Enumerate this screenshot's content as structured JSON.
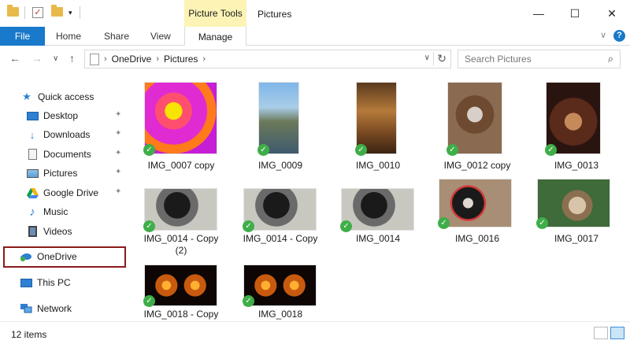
{
  "window": {
    "title": "Pictures",
    "context_tab": "Picture Tools",
    "minimize_glyph": "—",
    "maximize_glyph": "☐",
    "close_glyph": "✕"
  },
  "qat": {
    "dropdown_glyph": "▾",
    "check_glyph": "✓"
  },
  "ribbon": {
    "file_label": "File",
    "tabs": [
      "Home",
      "Share",
      "View"
    ],
    "manage_label": "Manage",
    "collapse_glyph": "∨",
    "help_glyph": "?"
  },
  "nav": {
    "back_glyph": "←",
    "forward_glyph": "→",
    "recent_glyph": "∨",
    "up_glyph": "↑",
    "breadcrumb": [
      "OneDrive",
      "Pictures"
    ],
    "crumb_sep": "›",
    "address_dropdown_glyph": "∨",
    "refresh_glyph": "↻"
  },
  "search": {
    "placeholder": "Search Pictures",
    "value": "",
    "icon_glyph": "⌕"
  },
  "sidebar": {
    "quick_access": "Quick access",
    "pin_glyph": "✦",
    "items": [
      {
        "label": "Desktop",
        "pinned": true
      },
      {
        "label": "Downloads",
        "pinned": true
      },
      {
        "label": "Documents",
        "pinned": true
      },
      {
        "label": "Pictures",
        "pinned": true
      },
      {
        "label": "Google Drive",
        "pinned": true
      },
      {
        "label": "Music",
        "pinned": false
      },
      {
        "label": "Videos",
        "pinned": false
      }
    ],
    "onedrive": "OneDrive",
    "this_pc": "This PC",
    "network": "Network"
  },
  "files": {
    "sync_glyph": "✓",
    "items": [
      {
        "name": "IMG_0007 copy"
      },
      {
        "name": "IMG_0009"
      },
      {
        "name": "IMG_0010"
      },
      {
        "name": "IMG_0012 copy"
      },
      {
        "name": "IMG_0013"
      },
      {
        "name": "IMG_0014 - Copy (2)"
      },
      {
        "name": "IMG_0014 - Copy"
      },
      {
        "name": "IMG_0014"
      },
      {
        "name": "IMG_0016"
      },
      {
        "name": "IMG_0017"
      },
      {
        "name": "IMG_0018 - Copy"
      },
      {
        "name": "IMG_0018"
      }
    ]
  },
  "status": {
    "count": "12 items"
  }
}
